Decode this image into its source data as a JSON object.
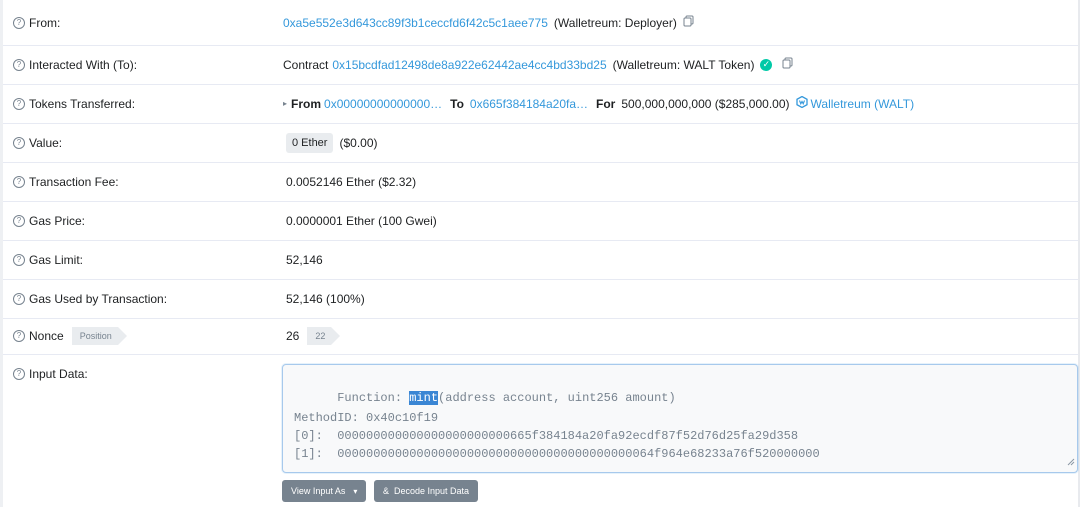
{
  "rows": {
    "from": {
      "label": "From:",
      "address": "0xa5e552e3d643cc89f3b1ceccfd6f42c5c1aee775",
      "tag": "(Walletreum: Deployer)"
    },
    "to": {
      "label": "Interacted With (To):",
      "prefix": "Contract",
      "address": "0x15bcdfad12498de8a922e62442ae4cc4bd33bd25",
      "tag": "(Walletreum: WALT Token)"
    },
    "tokens": {
      "label": "Tokens Transferred:",
      "from_label": "From",
      "from_address": "0x00000000000000…",
      "to_label": "To",
      "to_address": "0x665f384184a20fa…",
      "for_label": "For",
      "amount": "500,000,000,000 ($285,000.00)",
      "token": "Walletreum (WALT)"
    },
    "value": {
      "label": "Value:",
      "badge": "0 Ether",
      "usd": "($0.00)"
    },
    "fee": {
      "label": "Transaction Fee:",
      "value": "0.0052146 Ether ($2.32)"
    },
    "gas_price": {
      "label": "Gas Price:",
      "value": "0.0000001 Ether (100 Gwei)"
    },
    "gas_limit": {
      "label": "Gas Limit:",
      "value": "52,146"
    },
    "gas_used": {
      "label": "Gas Used by Transaction:",
      "value": "52,146 (100%)"
    },
    "nonce": {
      "label": "Nonce",
      "tag": "Position",
      "value": "26",
      "position": "22"
    },
    "input": {
      "label": "Input Data:",
      "function_prefix": "Function: ",
      "function_name": "mint",
      "function_args": "(address account, uint256 amount)",
      "method_id": "MethodID: 0x40c10f19",
      "param0": "[0]:  000000000000000000000000665f384184a20fa92ecdf87f52d76d25fa29d358",
      "param1": "[1]:  00000000000000000000000000000000000000000064f964e68233a76f520000000"
    }
  },
  "buttons": {
    "view_input": "View Input As",
    "decode": "Decode Input Data"
  },
  "colors": {
    "link": "#3498db",
    "verified": "#00c9a7",
    "button": "#77838f"
  },
  "icons": [
    "question-icon",
    "copy-icon",
    "verified-check-icon",
    "walt-token-icon",
    "caret-right-icon",
    "chevron-down-icon",
    "decode-icon"
  ]
}
